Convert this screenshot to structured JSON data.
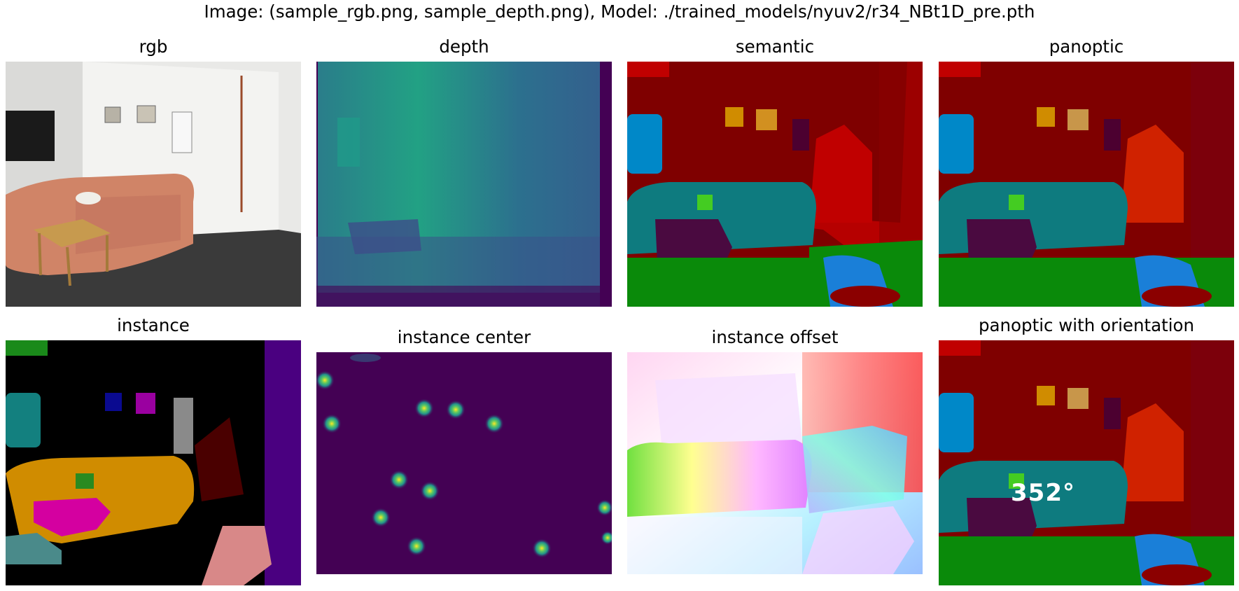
{
  "figure": {
    "suptitle": "Image: (sample_rgb.png, sample_depth.png), Model: ./trained_models/nyuv2/r34_NBt1D_pre.pth"
  },
  "panels": [
    {
      "title": "rgb"
    },
    {
      "title": "depth"
    },
    {
      "title": "semantic"
    },
    {
      "title": "panoptic"
    },
    {
      "title": "instance"
    },
    {
      "title": "instance center"
    },
    {
      "title": "instance offset"
    },
    {
      "title": "panoptic with orientation",
      "overlay_label": "352°"
    }
  ],
  "colors": {
    "wall_red": "#7f0000",
    "sofa_teal": "#0e7b7f",
    "floor_green": "#0a8a0a",
    "viridis_dark": "#440154",
    "viridis_mid": "#2a8c8a",
    "instance_orange": "#d08c00",
    "instance_magenta": "#d4008f"
  }
}
